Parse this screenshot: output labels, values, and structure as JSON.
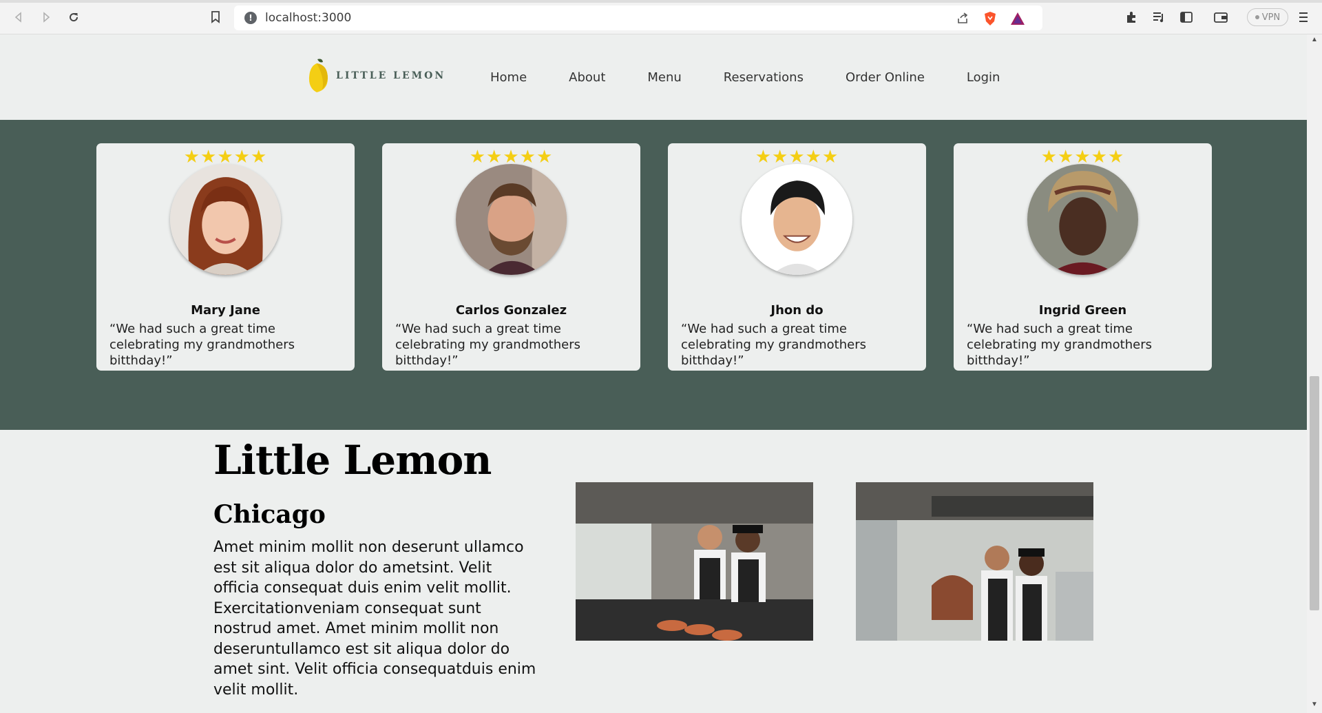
{
  "browser": {
    "url": "localhost:3000",
    "vpn_label": "VPN",
    "info_glyph": "!"
  },
  "site": {
    "brand": "LITTLE LEMON",
    "nav": [
      "Home",
      "About",
      "Menu",
      "Reservations",
      "Order Online",
      "Login"
    ]
  },
  "testimonials": [
    {
      "stars": "★★★★★",
      "rating": 5,
      "name": "Mary Jane",
      "quote": "“We had such a great time celebrating my grandmothers bitthday!”"
    },
    {
      "stars": "★★★★★",
      "rating": 5,
      "name": "Carlos Gonzalez",
      "quote": "“We had such a great time celebrating my grandmothers bitthday!”"
    },
    {
      "stars": "★★★★★",
      "rating": 5,
      "name": "Jhon do",
      "quote": "“We had such a great time celebrating my grandmothers bitthday!”"
    },
    {
      "stars": "★★★★★",
      "rating": 5,
      "name": "Ingrid Green",
      "quote": "“We had such a great time celebrating my grandmothers bitthday!”"
    }
  ],
  "about": {
    "title": "Little Lemon",
    "subtitle": "Chicago",
    "body": "Amet minim mollit non deserunt ullamco est sit aliqua dolor do ametsint. Velit officia consequat duis enim velit mollit. Exercitationveniam consequat sunt nostrud amet. Amet minim mollit non deseruntullamco est sit aliqua dolor do amet sint. Velit officia consequatduis enim velit mollit."
  },
  "colors": {
    "primary_green": "#495e57",
    "primary_yellow": "#f4ce14",
    "highlight": "#edefee"
  }
}
